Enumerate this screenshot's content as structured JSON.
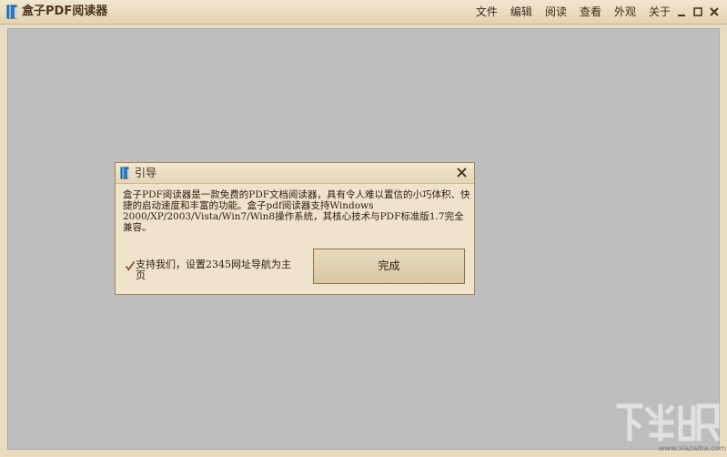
{
  "window": {
    "title": "盒子PDF阅读器",
    "icon": "book-icon"
  },
  "menu": {
    "items": [
      "文件",
      "编辑",
      "阅读",
      "查看",
      "外观",
      "关于"
    ]
  },
  "window_controls": [
    "minimize-icon",
    "maximize-icon",
    "close-icon"
  ],
  "dialog": {
    "title": "引导",
    "description": "盒子PDF阅读器是一款免费的PDF文档阅读器，具有令人难以置信的小巧体积、快捷的启动速度和丰富的功能。盒子pdf阅读器支持Windows 2000/XP/2003/Vista/Win7/Win8操作系统，其核心技术与PDF标准版1.7完全兼容。",
    "support_label": "支持我们，设置2345网址导航为主页",
    "support_checked": true,
    "done_label": "完成"
  },
  "watermark": {
    "text": "www.xiazaiba.com"
  },
  "colors": {
    "frame": "#eadcc2",
    "doc_area": "#bebebe",
    "dialog_bg": "#efe3cc",
    "accent_text": "#3d2c1a"
  }
}
